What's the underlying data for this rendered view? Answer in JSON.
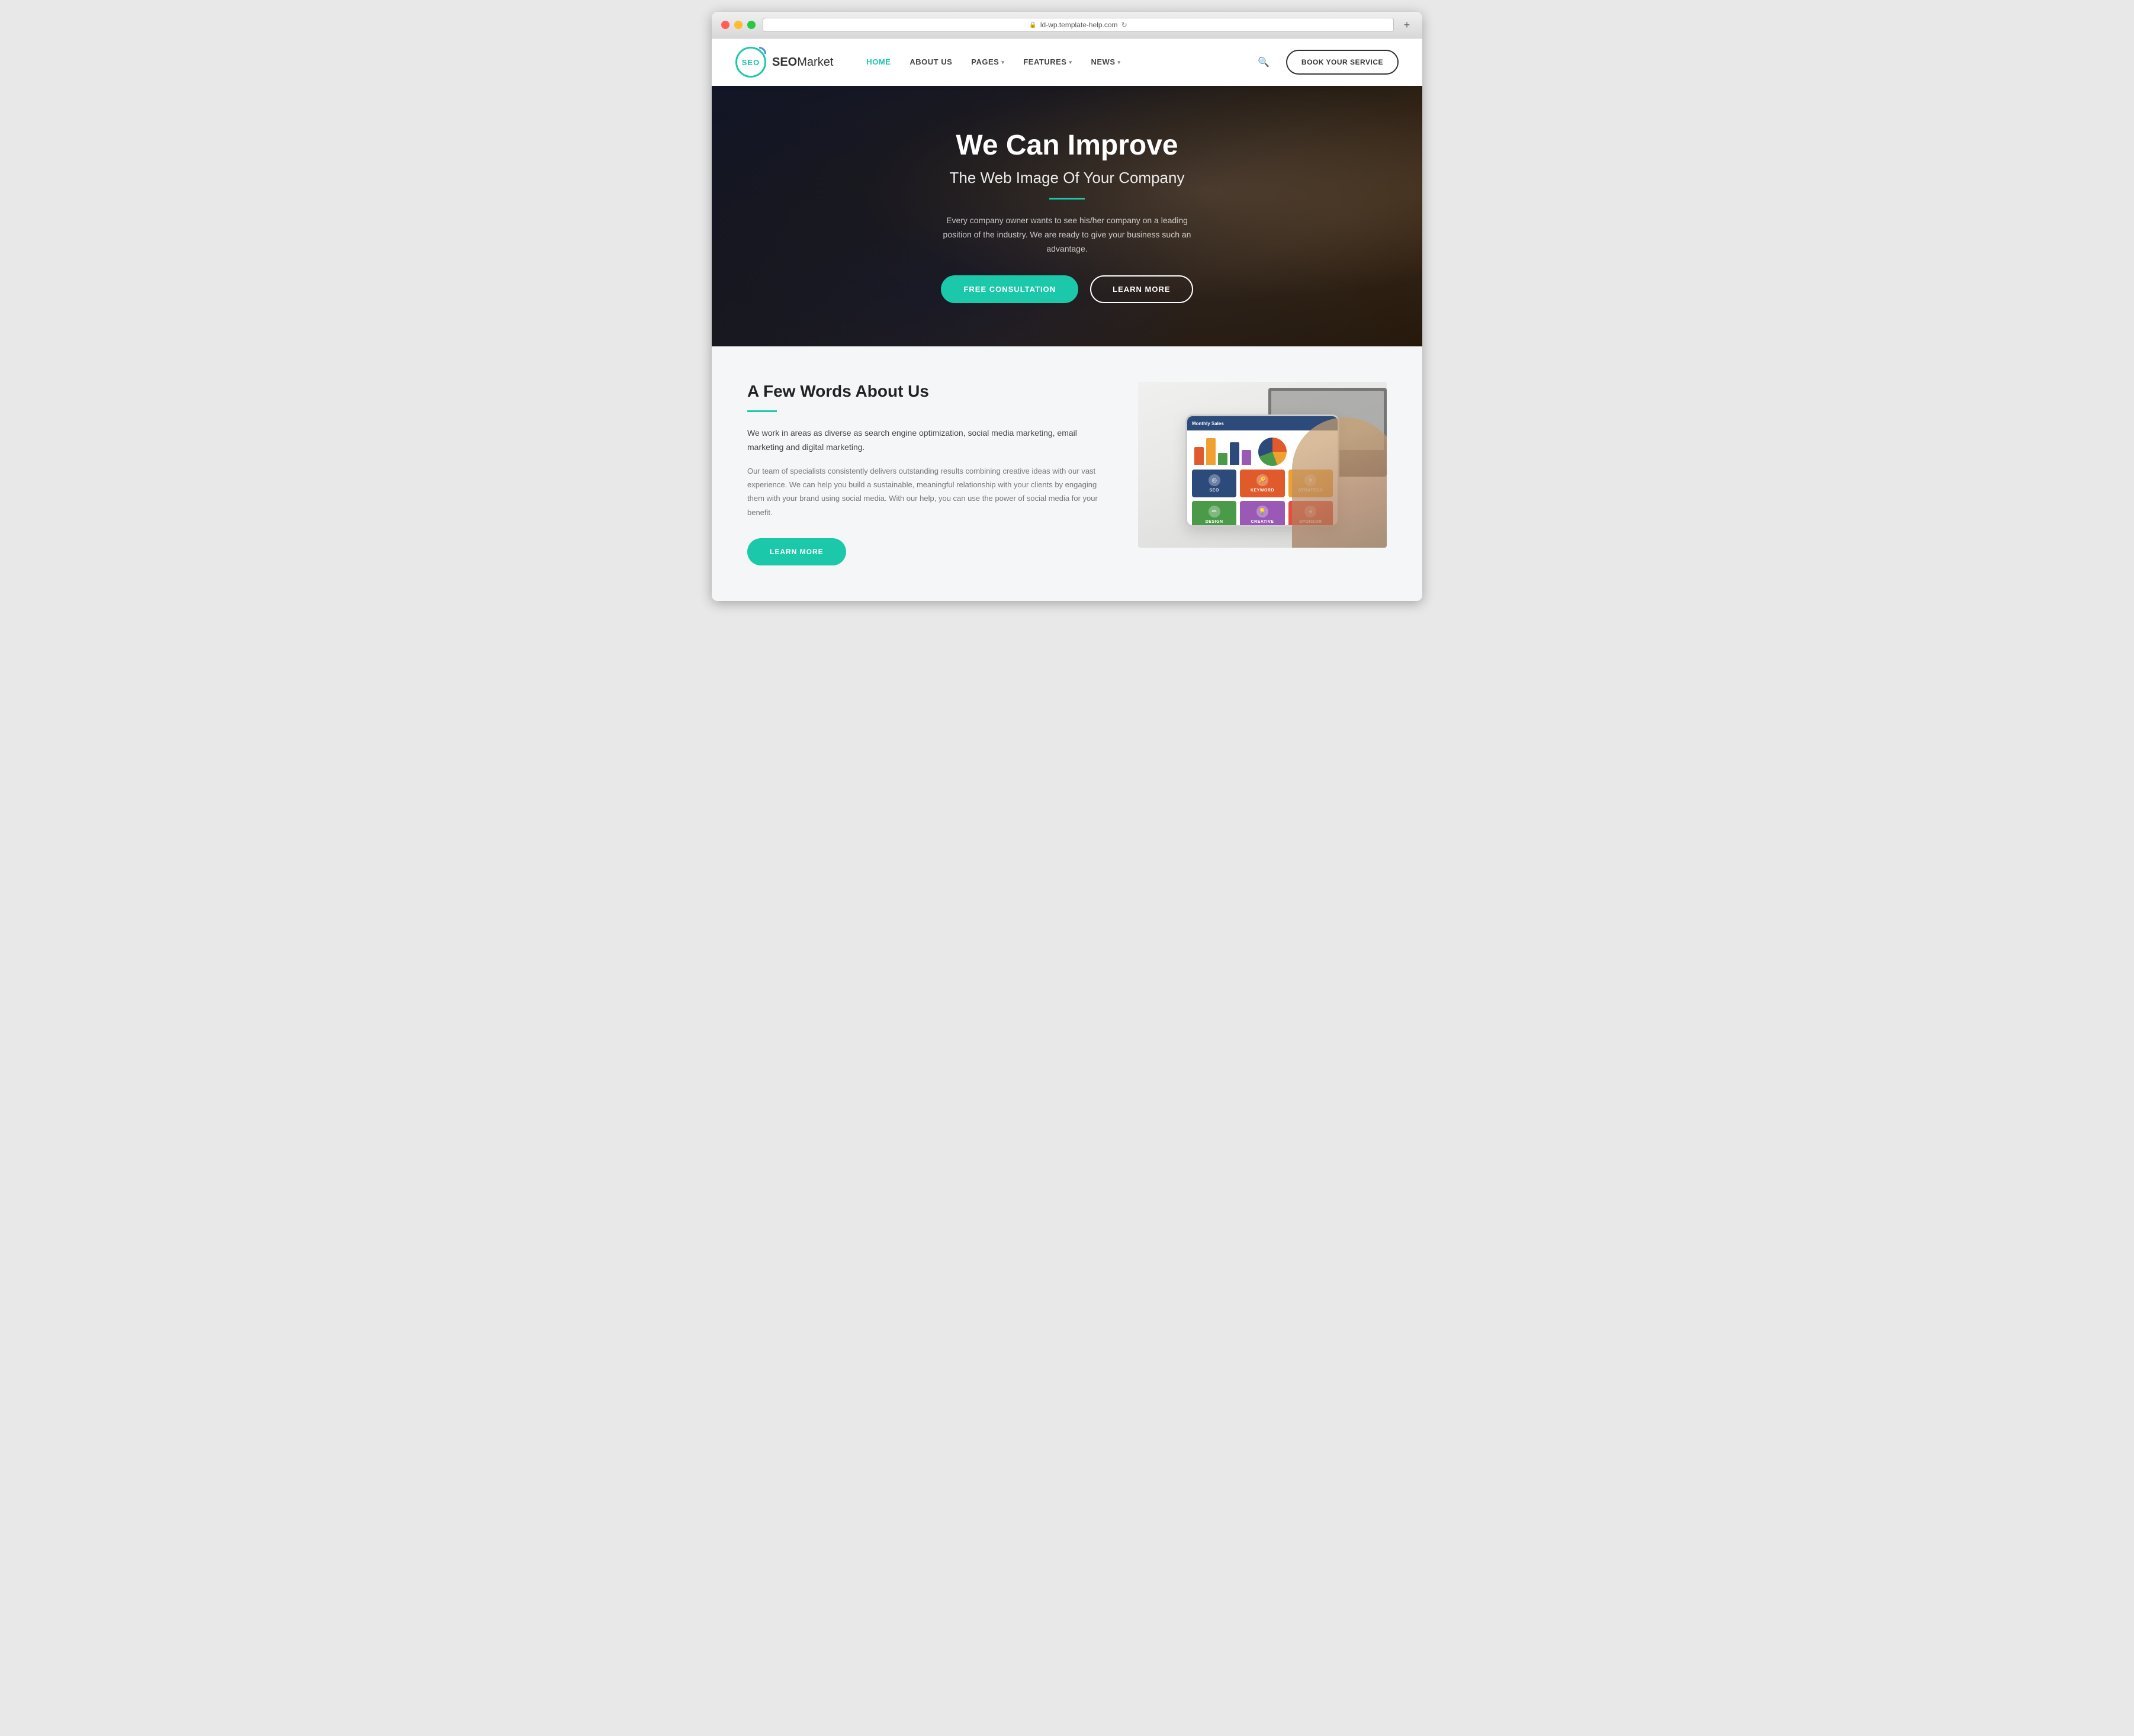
{
  "browser": {
    "url": "ld-wp.template-help.com",
    "btn_close": "×",
    "btn_min": "–",
    "btn_max": "+",
    "new_tab": "+"
  },
  "navbar": {
    "logo_text": "SEO",
    "brand_name_bold": "SEO",
    "brand_name_rest": "Market",
    "nav_items": [
      {
        "label": "HOME",
        "active": true,
        "has_dropdown": false
      },
      {
        "label": "ABOUT US",
        "active": false,
        "has_dropdown": false
      },
      {
        "label": "PAGES",
        "active": false,
        "has_dropdown": true
      },
      {
        "label": "FEATURES",
        "active": false,
        "has_dropdown": true
      },
      {
        "label": "NEWS",
        "active": false,
        "has_dropdown": true
      }
    ],
    "book_button": "BOOK YOUR SERVICE"
  },
  "hero": {
    "title": "We Can Improve",
    "subtitle": "The Web Image Of Your Company",
    "description": "Every company owner wants to see his/her company on a leading position of the industry. We are ready to give your business such an advantage.",
    "btn_primary": "FREE CONSULTATION",
    "btn_secondary": "LEARN MORE"
  },
  "about": {
    "heading": "A Few Words About Us",
    "lead": "We work in areas as diverse as search engine optimization, social media marketing, email marketing and digital marketing.",
    "body": "Our team of specialists consistently delivers outstanding results combining creative ideas with our vast experience. We can help you build a sustainable, meaningful relationship with your clients by engaging them with your brand using social media. With our help, you can use the power of social media for your benefit.",
    "learn_more": "LEARN MORE",
    "tablet_header": "Monthly Sales",
    "cards": [
      {
        "label": "SEO",
        "class": "card-seo",
        "icon": "◎"
      },
      {
        "label": "KEYWORD",
        "class": "card-key",
        "icon": "🔑"
      },
      {
        "label": "STRATEGY",
        "class": "card-star",
        "icon": "★"
      },
      {
        "label": "DESIGN",
        "class": "card-design",
        "icon": "✏"
      },
      {
        "label": "CREATIVE",
        "class": "card-creative",
        "icon": "💡"
      },
      {
        "label": "SPONSOR",
        "class": "card-sponsor",
        "icon": "♦"
      }
    ]
  },
  "colors": {
    "primary": "#1cc8aa",
    "dark": "#222222",
    "light_bg": "#f4f6f8"
  }
}
